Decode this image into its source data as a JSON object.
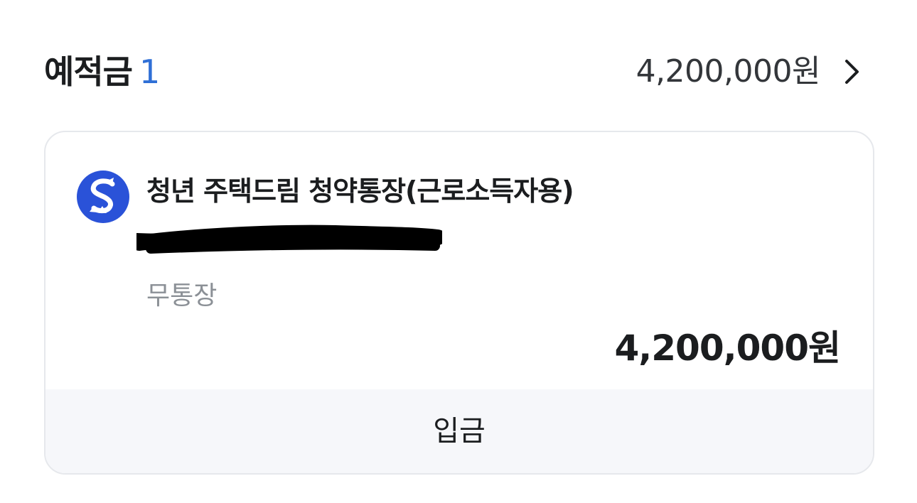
{
  "section": {
    "title": "예적금",
    "count": "1",
    "total_amount": "4,200,000원",
    "chevron_icon": "chevron-right-icon"
  },
  "account": {
    "bank_logo_icon": "shinhan-bank-logo-icon",
    "bank_logo_color": "#2a52d8",
    "name": "청년 주택드림 청약통장(근로소득자용)",
    "type": "무통장",
    "balance": "4,200,000원",
    "deposit_label": "입금"
  },
  "colors": {
    "accent": "#2f6fd6",
    "text_primary": "#1b1d1f",
    "text_secondary": "#8b9096",
    "card_border": "#e6e8ec",
    "footer_bg": "#f6f7fa"
  }
}
